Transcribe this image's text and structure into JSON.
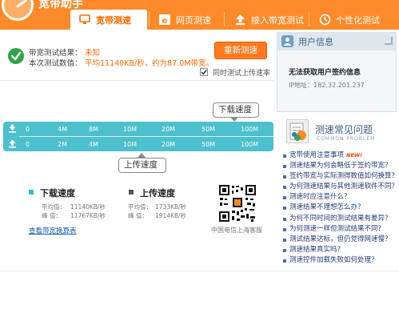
{
  "header": {
    "title": "宽带助手",
    "tabs": [
      {
        "label": "宽带测速",
        "icon": "monitor-icon",
        "active": true
      },
      {
        "label": "网页测速",
        "icon": "browser-icon",
        "active": false
      },
      {
        "label": "接入带宽测试",
        "icon": "upload-icon",
        "active": false
      },
      {
        "label": "个性化测试",
        "icon": "clock-icon",
        "active": false
      }
    ]
  },
  "result": {
    "label_result": "带宽测试结果：",
    "value_result": "未知",
    "label_value": "本次测试数值：",
    "value_value": "平均11140KB/秒，约为87.0M带宽。",
    "retest_button": "重新测速",
    "upload_checkbox_label": "同时测试上传速率",
    "upload_checked": true
  },
  "speedbar": {
    "download_callout": "下载速度",
    "upload_callout": "上传速度",
    "download_ticks": [
      "0",
      "4M",
      "8M",
      "10M",
      "20M",
      "50M",
      "100M"
    ],
    "upload_ticks": [
      "0",
      "2M",
      "4M",
      "10M",
      "20M",
      "50M",
      "100M"
    ],
    "progress_fraction": 1.0
  },
  "stats": {
    "download": {
      "title": "下载速度",
      "avg_label": "平均值：",
      "avg_value": "11140KB/秒",
      "peak_label": "峰  值：",
      "peak_value": "11767KB/秒"
    },
    "upload": {
      "title": "上传速度",
      "avg_label": "平均值：",
      "avg_value": "1733KB/秒",
      "peak_label": "峰  值：",
      "peak_value": "1914KB/秒"
    },
    "link_calc": "查看带宽换算表",
    "qr_caption": "中国电信上海客服"
  },
  "user": {
    "title": "用户信息",
    "no_user": "无法获取用户签约信息",
    "ip": "IP地址：182.32.201.237"
  },
  "faq": {
    "title": "测速常见问题",
    "subtitle": "COMMON PROBLEM",
    "items": [
      {
        "text": "宽带使用注意事项",
        "badge": "NEW!"
      },
      {
        "text": "测速结果为何会略低于签约带宽？"
      },
      {
        "text": "签约带宽与实际测得数值如何换算？"
      },
      {
        "text": "为何测速结果与其他测速软件不同？"
      },
      {
        "text": "测速时应注意什么？"
      },
      {
        "text": "测速结果不理想怎么办？"
      },
      {
        "text": "为何不同时间的测试结果有差异？"
      },
      {
        "text": "为何测速一样但测试结果不同？"
      },
      {
        "text": "测试结果达标，但仍觉得网速慢？"
      },
      {
        "text": "测速结果真实吗？"
      },
      {
        "text": "测速控件加载失败如何处理？"
      }
    ]
  },
  "colors": {
    "header_orange": "#ff8a2a",
    "accent_orange": "#ff6a00",
    "bar_teal": "#4cc0cc",
    "download_marker": "#28c0cc",
    "upload_marker": "#555555",
    "check_green": "#2fa34a",
    "link_blue": "#1a55b0"
  }
}
